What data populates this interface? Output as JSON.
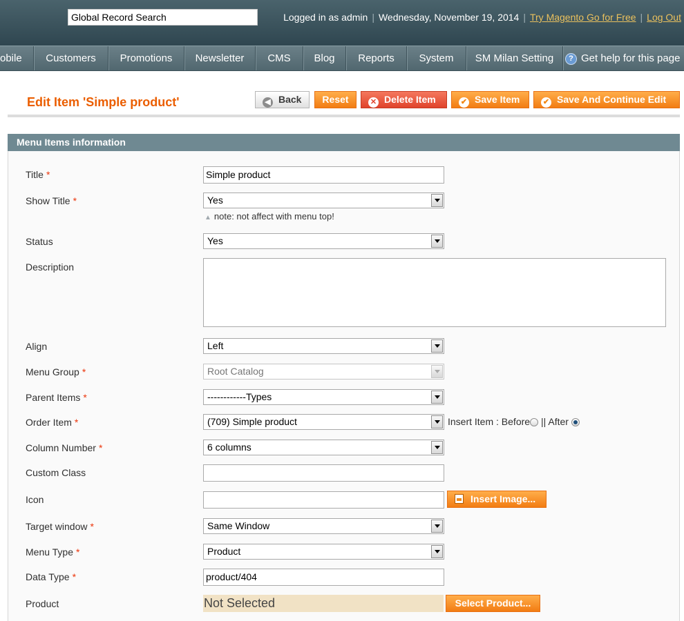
{
  "header": {
    "search_placeholder": "Global Record Search",
    "logged_in": "Logged in as admin",
    "date": "Wednesday, November 19, 2014",
    "try_link": "Try Magento Go for Free",
    "logout": "Log Out"
  },
  "nav": {
    "items": [
      "obile",
      "Customers",
      "Promotions",
      "Newsletter",
      "CMS",
      "Blog",
      "Reports",
      "System",
      "SM Milan Setting"
    ],
    "help": "Get help for this page"
  },
  "page": {
    "title": "Edit Item 'Simple product'",
    "buttons": {
      "back": "Back",
      "reset": "Reset",
      "delete": "Delete Item",
      "save": "Save Item",
      "save_continue": "Save And Continue Edit"
    }
  },
  "form": {
    "section_title": "Menu Items information",
    "title": {
      "label": "Title",
      "value": "Simple product"
    },
    "show_title": {
      "label": "Show Title",
      "value": "Yes",
      "note": "note: not affect with menu top!"
    },
    "status": {
      "label": "Status",
      "value": "Yes"
    },
    "description": {
      "label": "Description",
      "value": ""
    },
    "align": {
      "label": "Align",
      "value": "Left"
    },
    "menu_group": {
      "label": "Menu Group",
      "value": "Root Catalog"
    },
    "parent_items": {
      "label": "Parent Items",
      "value": "------------Types"
    },
    "order_item": {
      "label": "Order Item",
      "value": "(709) Simple product",
      "insert_label": "Insert Item : Before",
      "separator": "||",
      "after_label": "After",
      "selected_position": "After"
    },
    "column_number": {
      "label": "Column Number",
      "value": "6 columns"
    },
    "custom_class": {
      "label": "Custom Class",
      "value": ""
    },
    "icon": {
      "label": "Icon",
      "value": "",
      "button": "Insert Image..."
    },
    "target_window": {
      "label": "Target window",
      "value": "Same Window"
    },
    "menu_type": {
      "label": "Menu Type",
      "value": "Product"
    },
    "data_type": {
      "label": "Data Type",
      "value": "product/404"
    },
    "product": {
      "label": "Product",
      "value": "Not Selected",
      "button": "Select Product..."
    }
  },
  "colors": {
    "accent": "#eb5e00",
    "button_orange": "#f27d13",
    "header_bg": "#2f4650",
    "section_header": "#6f8992",
    "required": "#eb340a"
  }
}
